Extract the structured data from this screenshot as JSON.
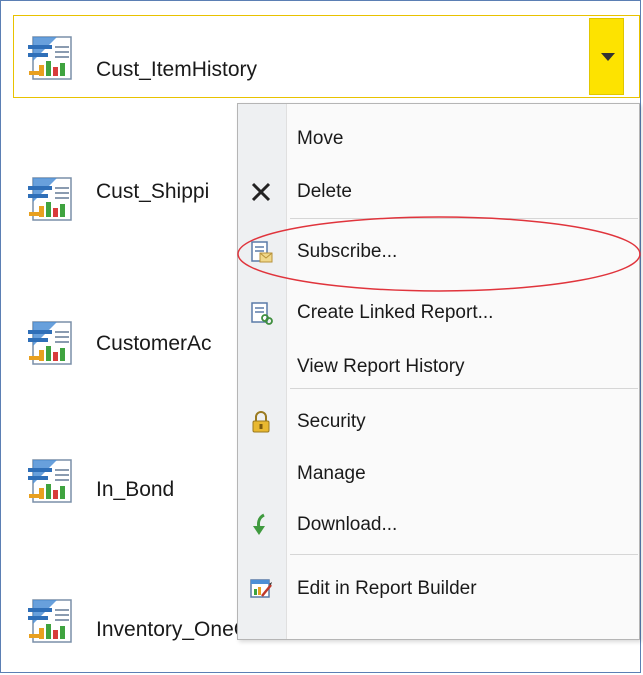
{
  "reports": [
    {
      "name": "Cust_ItemHistory"
    },
    {
      "name": "Cust_Shippi"
    },
    {
      "name": "CustomerAc"
    },
    {
      "name": "In_Bond"
    },
    {
      "name": "Inventory_OneCustomerWithPO"
    }
  ],
  "context_menu": {
    "items": [
      {
        "label": "Move",
        "icon": "none"
      },
      {
        "label": "Delete",
        "icon": "close-icon"
      },
      {
        "label": "Subscribe...",
        "icon": "subscribe-icon"
      },
      {
        "label": "Create Linked Report...",
        "icon": "linked-report-icon"
      },
      {
        "label": "View Report History",
        "icon": "none"
      },
      {
        "label": "Security",
        "icon": "lock-icon"
      },
      {
        "label": "Manage",
        "icon": "none"
      },
      {
        "label": "Download...",
        "icon": "download-icon"
      },
      {
        "label": "Edit in Report Builder",
        "icon": "report-builder-icon"
      }
    ]
  },
  "colors": {
    "selection_border": "#e8c200",
    "dropdown_bg": "#fde300",
    "highlight_ellipse": "#e0343c",
    "frame_border": "#5b7fb4"
  }
}
